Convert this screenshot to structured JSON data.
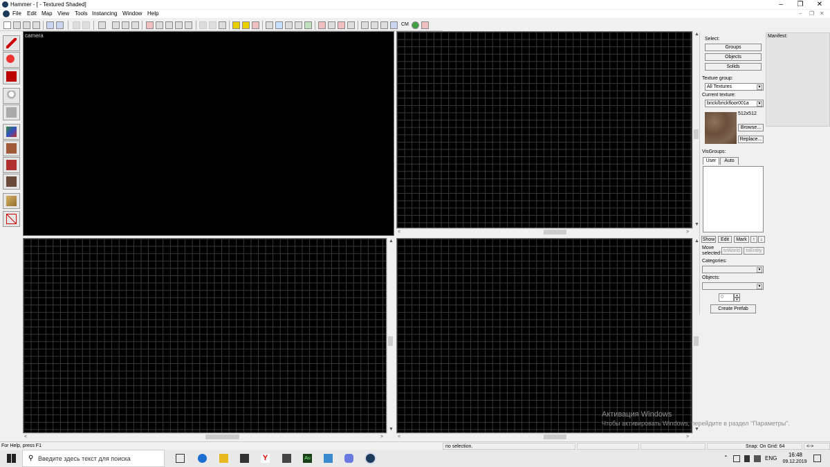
{
  "window": {
    "title": "Hammer - [ - Textured Shaded]",
    "minimize_icon": "minimize-icon",
    "maximize_icon": "restore-icon",
    "close_icon": "close-icon"
  },
  "menu": {
    "items": [
      "File",
      "Edit",
      "Map",
      "View",
      "Tools",
      "Instancing",
      "Window",
      "Help"
    ]
  },
  "toolbar": {
    "cm_label": "CM"
  },
  "viewports": {
    "camera_label": "camera"
  },
  "right_panel": {
    "select_label": "Select:",
    "groups_button": "Groups",
    "objects_button": "Objects",
    "solids_button": "Solids",
    "texture_group_label": "Texture group:",
    "texture_group_value": "All Textures",
    "current_texture_label": "Current texture:",
    "current_texture_value": "brick/brickfloor001a",
    "texture_size": "512x512",
    "browse_button": "Browse...",
    "replace_button": "Replace...",
    "visgroups_label": "VisGroups:",
    "tab_user": "User",
    "tab_auto": "Auto",
    "show_button": "Show",
    "edit_button": "Edit",
    "mark_button": "Mark",
    "move_selected_label_1": "Move",
    "move_selected_label_2": "selected:",
    "to_world_button": "toWorld",
    "to_entity_button": "toEntity",
    "categories_label": "Categories:",
    "objects_label": "Objects:",
    "spinner_value": "0",
    "create_prefab_button": "Create Prefab"
  },
  "manifest": {
    "label": "Manifest:"
  },
  "status": {
    "help": "For Help, press F1",
    "selection": "no selection.",
    "snap": "Snap: On Grid: 64",
    "extra": "<->"
  },
  "watermark": {
    "line1": "Активация Windows",
    "line2": "Чтобы активировать Windows, перейдите в раздел \"Параметры\"."
  },
  "taskbar": {
    "search_placeholder": "Введите здесь текст для поиска",
    "lang": "ENG",
    "time": "16:48",
    "date": "09.12.2019"
  }
}
